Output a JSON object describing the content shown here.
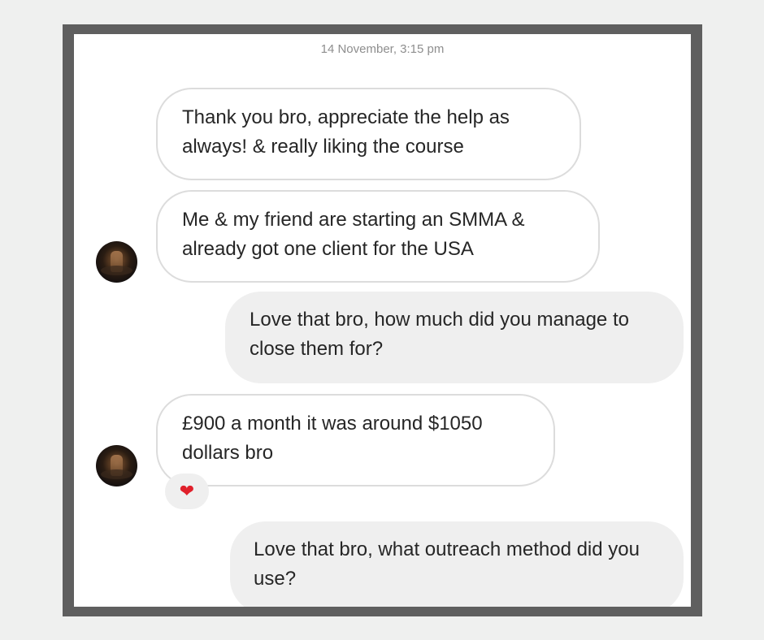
{
  "conversation": {
    "timestamp": "14 November, 3:15 pm",
    "messages": [
      {
        "direction": "incoming",
        "text": "Thank you bro, appreciate the help as always! & really liking the course"
      },
      {
        "direction": "incoming",
        "text": "Me & my friend are starting an SMMA & already got one client for the USA"
      },
      {
        "direction": "outgoing",
        "text": "Love that bro, how much did you manage to close them for?"
      },
      {
        "direction": "incoming",
        "text": "£900 a month it was around $1050 dollars bro",
        "reaction": "heart-icon"
      },
      {
        "direction": "outgoing",
        "text": "Love that bro, what outreach method did you use?"
      }
    ]
  },
  "colors": {
    "frame": "#5f5f5f",
    "page_background": "#eff0ef",
    "incoming_border": "#dcdcdc",
    "outgoing_background": "#efefef",
    "reaction_heart": "#e0202b"
  }
}
